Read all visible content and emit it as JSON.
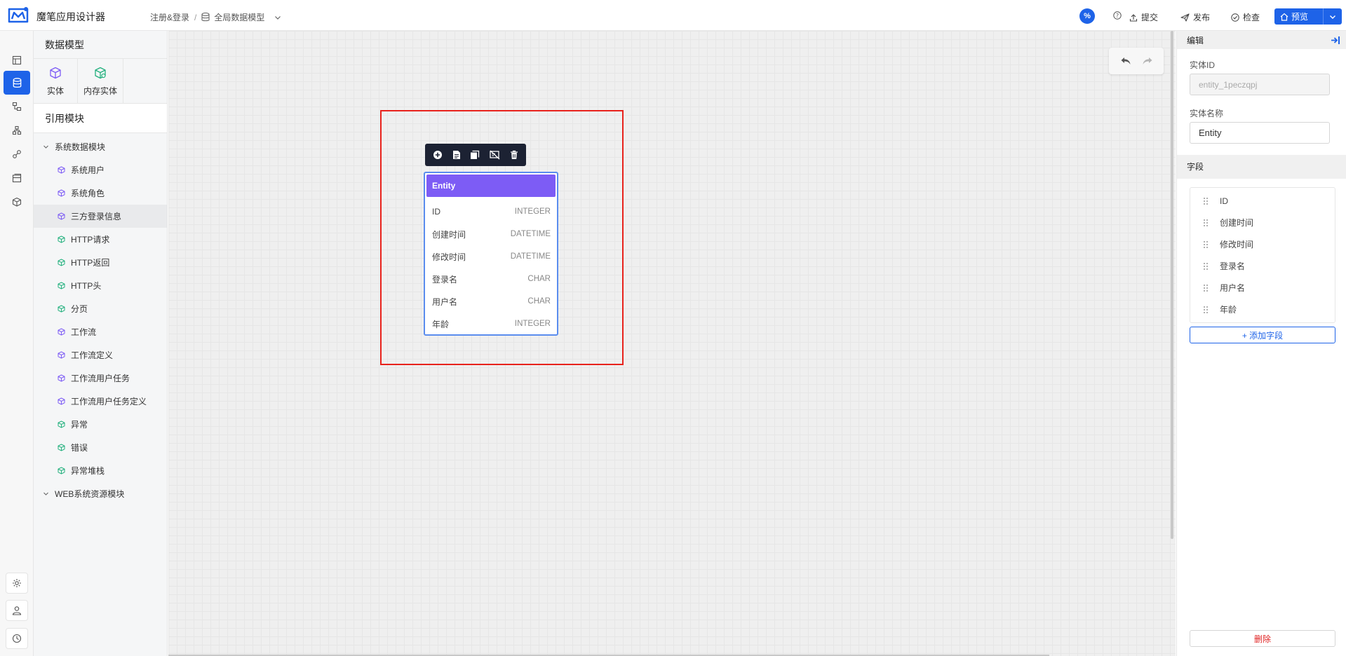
{
  "app": {
    "title": "魔笔应用设计器",
    "accent_color": "#1e63e8"
  },
  "breadcrumb": {
    "project": "注册&登录",
    "separator": "/",
    "current": "全局数据模型"
  },
  "header_actions": {
    "badge": "%",
    "submit": "提交",
    "publish": "发布",
    "check": "检查",
    "preview": "预览"
  },
  "rail": {
    "items": [
      "layout-icon",
      "database-icon",
      "flow-icon",
      "hierarchy-icon",
      "link-icon",
      "page-icon",
      "cube-icon"
    ],
    "bottom": [
      "settings-icon",
      "user-icon",
      "history-icon"
    ]
  },
  "left_panel": {
    "title": "数据模型",
    "types": [
      {
        "label": "实体",
        "icon": "cube-icon",
        "color": "#7d5cf5"
      },
      {
        "label": "内存实体",
        "icon": "cube-memory-icon",
        "color": "#22b07d"
      }
    ],
    "ref_title": "引用模块",
    "groups": [
      {
        "label": "系统数据模块",
        "items": [
          {
            "label": "系统用户",
            "kind": "entity"
          },
          {
            "label": "系统角色",
            "kind": "entity"
          },
          {
            "label": "三方登录信息",
            "kind": "entity"
          },
          {
            "label": "HTTP请求",
            "kind": "memory"
          },
          {
            "label": "HTTP返回",
            "kind": "memory"
          },
          {
            "label": "HTTP头",
            "kind": "memory"
          },
          {
            "label": "分页",
            "kind": "memory"
          },
          {
            "label": "工作流",
            "kind": "entity"
          },
          {
            "label": "工作流定义",
            "kind": "entity"
          },
          {
            "label": "工作流用户任务",
            "kind": "entity"
          },
          {
            "label": "工作流用户任务定义",
            "kind": "entity"
          },
          {
            "label": "异常",
            "kind": "memory"
          },
          {
            "label": "错误",
            "kind": "memory"
          },
          {
            "label": "异常堆栈",
            "kind": "memory"
          }
        ]
      },
      {
        "label": "WEB系统资源模块",
        "items": []
      }
    ]
  },
  "canvas": {
    "entity": {
      "name": "Entity",
      "header_color": "#7d5cf5",
      "fields": [
        {
          "name": "ID",
          "type": "INTEGER"
        },
        {
          "name": "创建时间",
          "type": "DATETIME"
        },
        {
          "name": "修改时间",
          "type": "DATETIME"
        },
        {
          "name": "登录名",
          "type": "CHAR"
        },
        {
          "name": "用户名",
          "type": "CHAR"
        },
        {
          "name": "年龄",
          "type": "INTEGER"
        }
      ]
    },
    "toolbar_icons": [
      "add-field-icon",
      "document-icon",
      "copy-icon",
      "edit-off-icon",
      "trash-icon"
    ]
  },
  "right_panel": {
    "title": "编辑",
    "entity_id_label": "实体ID",
    "entity_id_value": "entity_1peczqpj",
    "entity_name_label": "实体名称",
    "entity_name_value": "Entity",
    "fields_title": "字段",
    "fields": [
      "ID",
      "创建时间",
      "修改时间",
      "登录名",
      "用户名",
      "年龄"
    ],
    "add_field": "+ 添加字段",
    "delete": "删除",
    "delete_color": "#e02424"
  }
}
